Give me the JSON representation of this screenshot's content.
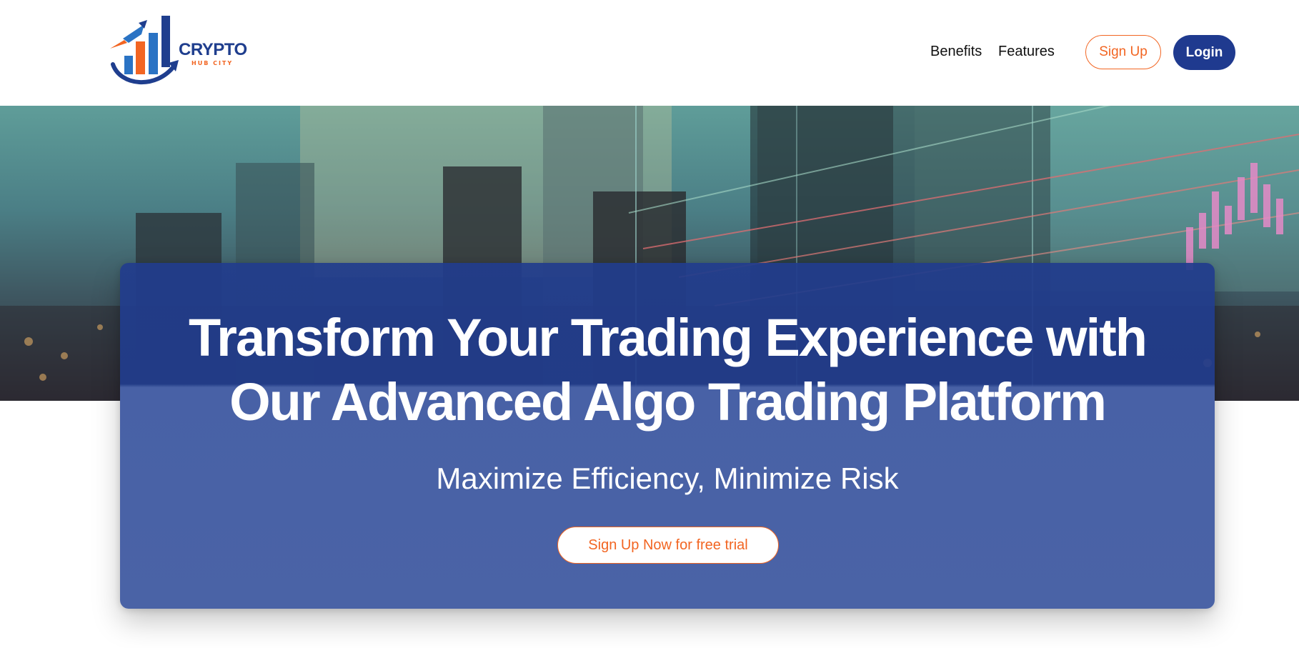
{
  "brand": {
    "name": "CRYPTO",
    "tagline": "HUB CITY",
    "colors": {
      "primary": "#1f3a8f",
      "accent": "#f26522"
    }
  },
  "nav": {
    "links": [
      {
        "label": "Benefits"
      },
      {
        "label": "Features"
      }
    ],
    "signup_label": "Sign Up",
    "login_label": "Login"
  },
  "hero": {
    "background_image": "city-skyline-with-trading-charts",
    "title_line1": "Transform Your Trading Experience with",
    "title_line2": "Our Advanced Algo Trading Platform",
    "subtitle": "Maximize Efficiency, Minimize Risk",
    "cta_label": "Sign Up Now for free trial"
  }
}
